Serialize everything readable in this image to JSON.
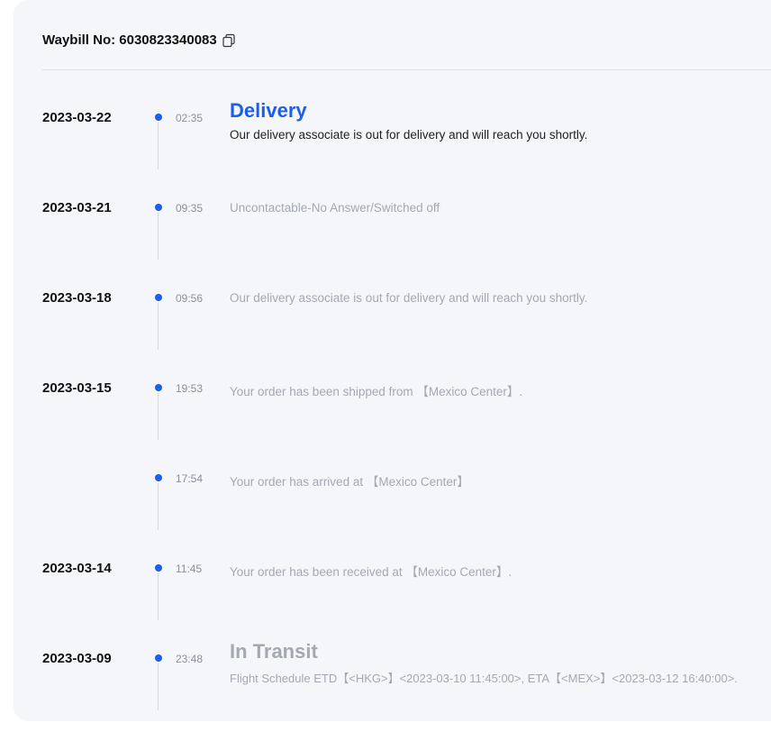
{
  "header": {
    "waybill_label": "Waybill No: 6030823340083"
  },
  "events": [
    {
      "date": "2023-03-22",
      "time": "02:35",
      "status": "Delivery",
      "desc": "Our delivery associate is out for delivery and will reach you shortly."
    },
    {
      "date": "2023-03-21",
      "time": "09:35",
      "status": "",
      "desc": "Uncontactable-No Answer/Switched off"
    },
    {
      "date": "2023-03-18",
      "time": "09:56",
      "status": "",
      "desc": "Our delivery associate is out for delivery and will reach you shortly."
    },
    {
      "date": "2023-03-15",
      "time": "19:53",
      "status": "",
      "desc": "Your order has been shipped from 【Mexico Center】."
    },
    {
      "date": "",
      "time": "17:54",
      "status": "",
      "desc": "Your order has arrived at 【Mexico Center】"
    },
    {
      "date": "2023-03-14",
      "time": "11:45",
      "status": "",
      "desc": "Your order has been received at 【Mexico Center】."
    },
    {
      "date": "2023-03-09",
      "time": "23:48",
      "status": "In Transit",
      "desc": "Flight Schedule ETD【<HKG>】<2023-03-10 11:45:00>, ETA【<MEX>】<2023-03-12 16:40:00>."
    }
  ],
  "colors": {
    "accent": "#1a5ef0",
    "muted": "#a4a8b1",
    "card_bg": "#f5f6fa"
  },
  "icons": {
    "copy": "copy-icon"
  }
}
